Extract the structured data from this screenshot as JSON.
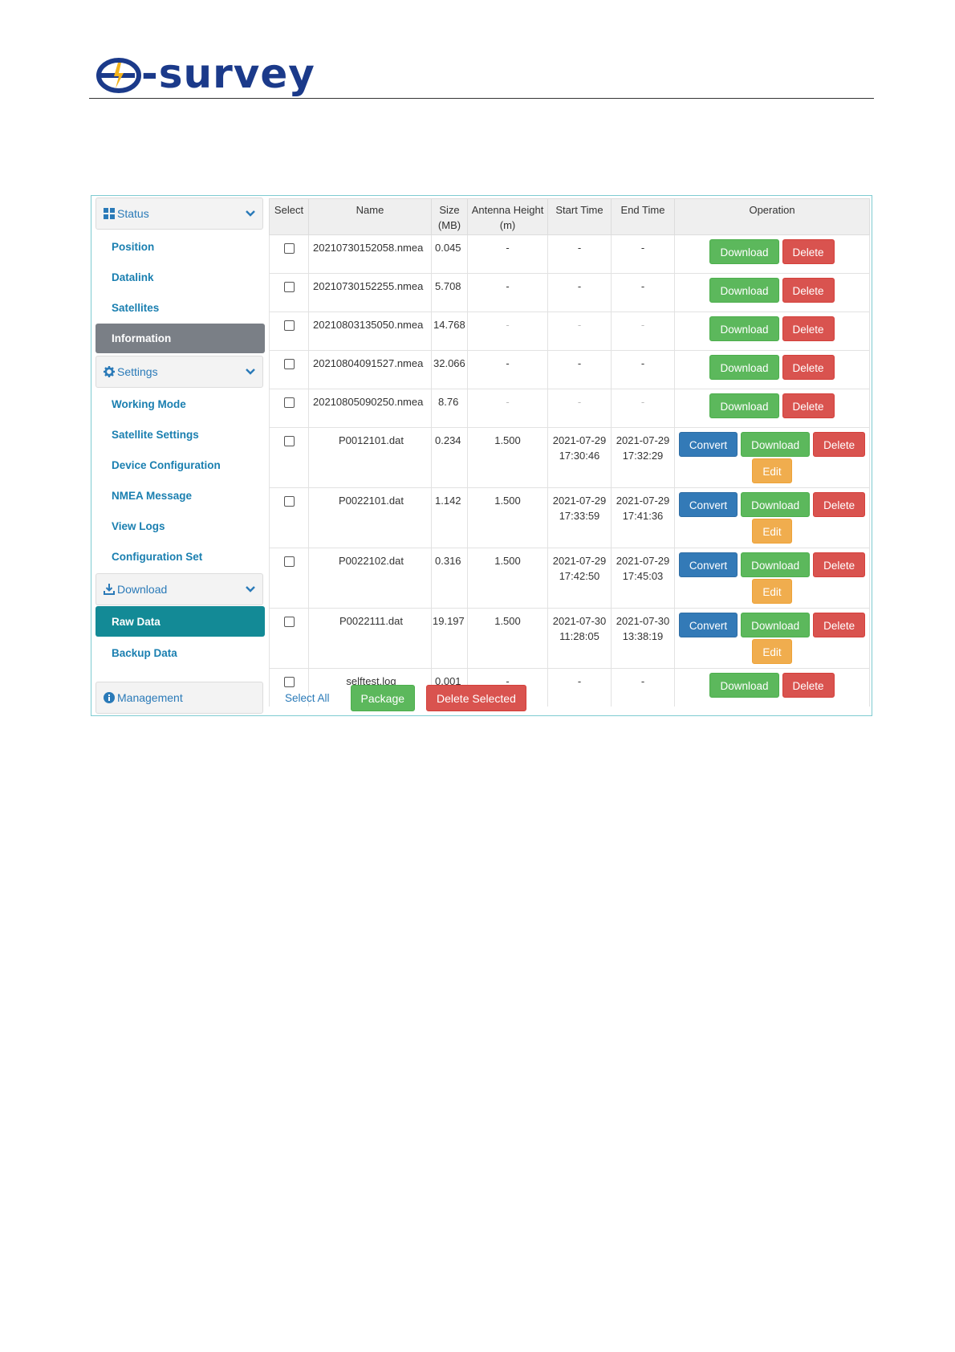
{
  "brand": {
    "name": "-survey",
    "logo_color": "#1b3a8a",
    "accent_color": "#f2b21a"
  },
  "sidebar": {
    "groups": [
      {
        "label": "Status",
        "icon": "dashboard-icon",
        "items": [
          "Position",
          "Datalink",
          "Satellites",
          "Information"
        ]
      },
      {
        "label": "Settings",
        "icon": "gear-icon",
        "items": [
          "Working Mode",
          "Satellite Settings",
          "Device Configuration",
          "NMEA Message",
          "View Logs",
          "Configuration Set"
        ]
      },
      {
        "label": "Download",
        "icon": "download-icon",
        "items": [
          "Raw Data",
          "Backup Data"
        ]
      },
      {
        "label": "Management",
        "icon": "info-circle-icon",
        "items": []
      }
    ],
    "active_item": "Raw Data",
    "highlight_item": "Information"
  },
  "table": {
    "headers": {
      "select": "Select",
      "name": "Name",
      "size_line1": "Size",
      "size_line2": "(MB)",
      "height_line1": "Antenna Height",
      "height_line2": "(m)",
      "start": "Start Time",
      "end": "End Time",
      "operation": "Operation"
    },
    "buttons": {
      "convert": "Convert",
      "download": "Download",
      "delete": "Delete",
      "edit": "Edit"
    },
    "rows": [
      {
        "name": "20210730152058.nmea",
        "size": "0.045",
        "height": "-",
        "start": [
          "-"
        ],
        "end": [
          "-"
        ]
      },
      {
        "name": "20210730152255.nmea",
        "size": "5.708",
        "height": "-",
        "start": [
          "-"
        ],
        "end": [
          "-"
        ]
      },
      {
        "name": "20210803135050.nmea",
        "size": "14.768",
        "height": "-",
        "start": [
          "-"
        ],
        "end": [
          "-"
        ]
      },
      {
        "name": "20210804091527.nmea",
        "size": "32.066",
        "height": "-",
        "start": [
          "-"
        ],
        "end": [
          "-"
        ]
      },
      {
        "name": "20210805090250.nmea",
        "size": "8.76",
        "height": "-",
        "start": [
          "-"
        ],
        "end": [
          "-"
        ]
      },
      {
        "name": "P0012101.dat",
        "size": "0.234",
        "height": "1.500",
        "start": [
          "2021-07-29",
          "17:30:46"
        ],
        "end": [
          "2021-07-29",
          "17:32:29"
        ]
      },
      {
        "name": "P0022101.dat",
        "size": "1.142",
        "height": "1.500",
        "start": [
          "2021-07-29",
          "17:33:59"
        ],
        "end": [
          "2021-07-29",
          "17:41:36"
        ]
      },
      {
        "name": "P0022102.dat",
        "size": "0.316",
        "height": "1.500",
        "start": [
          "2021-07-29",
          "17:42:50"
        ],
        "end": [
          "2021-07-29",
          "17:45:03"
        ]
      },
      {
        "name": "P0022111.dat",
        "size": "19.197",
        "height": "1.500",
        "start": [
          "2021-07-30",
          "11:28:05"
        ],
        "end": [
          "2021-07-30",
          "13:38:19"
        ]
      },
      {
        "name": "selftest.log",
        "size": "0.001",
        "height": "-",
        "start": [
          "-"
        ],
        "end": [
          "-"
        ]
      }
    ]
  },
  "footer": {
    "select_all": "Select All",
    "package": "Package",
    "delete_selected": "Delete Selected"
  }
}
